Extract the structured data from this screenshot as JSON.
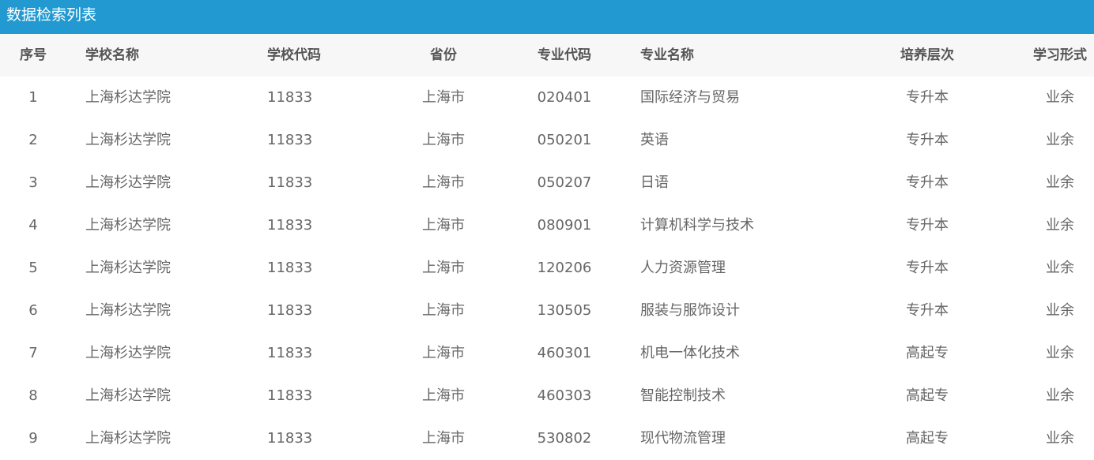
{
  "title": "数据检索列表",
  "columns": [
    "序号",
    "学校名称",
    "学校代码",
    "省份",
    "专业代码",
    "专业名称",
    "培养层次",
    "学习形式"
  ],
  "rows": [
    [
      "1",
      "上海杉达学院",
      "11833",
      "上海市",
      "020401",
      "国际经济与贸易",
      "专升本",
      "业余"
    ],
    [
      "2",
      "上海杉达学院",
      "11833",
      "上海市",
      "050201",
      "英语",
      "专升本",
      "业余"
    ],
    [
      "3",
      "上海杉达学院",
      "11833",
      "上海市",
      "050207",
      "日语",
      "专升本",
      "业余"
    ],
    [
      "4",
      "上海杉达学院",
      "11833",
      "上海市",
      "080901",
      "计算机科学与技术",
      "专升本",
      "业余"
    ],
    [
      "5",
      "上海杉达学院",
      "11833",
      "上海市",
      "120206",
      "人力资源管理",
      "专升本",
      "业余"
    ],
    [
      "6",
      "上海杉达学院",
      "11833",
      "上海市",
      "130505",
      "服装与服饰设计",
      "专升本",
      "业余"
    ],
    [
      "7",
      "上海杉达学院",
      "11833",
      "上海市",
      "460301",
      "机电一体化技术",
      "高起专",
      "业余"
    ],
    [
      "8",
      "上海杉达学院",
      "11833",
      "上海市",
      "460303",
      "智能控制技术",
      "高起专",
      "业余"
    ],
    [
      "9",
      "上海杉达学院",
      "11833",
      "上海市",
      "530802",
      "现代物流管理",
      "高起专",
      "业余"
    ]
  ]
}
